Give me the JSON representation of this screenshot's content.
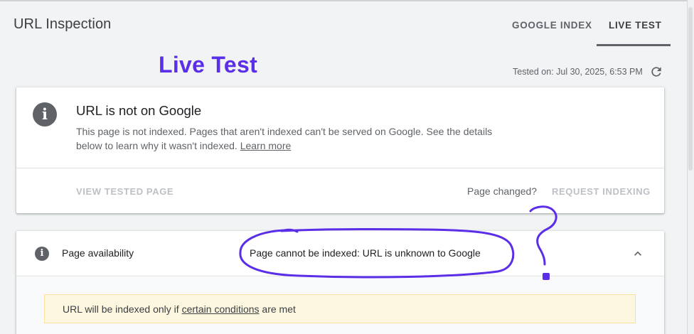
{
  "header": {
    "title": "URL Inspection",
    "tabs": [
      {
        "label": "GOOGLE INDEX",
        "active": false
      },
      {
        "label": "LIVE TEST",
        "active": true
      }
    ]
  },
  "annotation": {
    "label": "Live Test",
    "question_mark": "?",
    "color": "#5b2ee8"
  },
  "tested_on": "Tested on: Jul 30, 2025, 6:53 PM",
  "status_card": {
    "icon": "info-icon",
    "title": "URL is not on Google",
    "desc_before_link": "This page is not indexed. Pages that aren't indexed can't be served on Google. See the details below to learn why it wasn't indexed. ",
    "link_label": "Learn more",
    "view_tested_label": "VIEW TESTED PAGE",
    "page_changed_label": "Page changed?",
    "request_indexing_label": "REQUEST INDEXING"
  },
  "availability": {
    "label": "Page availability",
    "status": "Page cannot be indexed: URL is unknown to Google",
    "icon": "info-icon",
    "expanded": true,
    "warning_before": "URL will be indexed only if ",
    "warning_link": "certain conditions",
    "warning_after": " are met"
  },
  "colors": {
    "background": "#f1f3f4",
    "muted_button": "#bdc1c6",
    "warning_bg": "#fef7e0",
    "tab_active": "#5f6368"
  }
}
